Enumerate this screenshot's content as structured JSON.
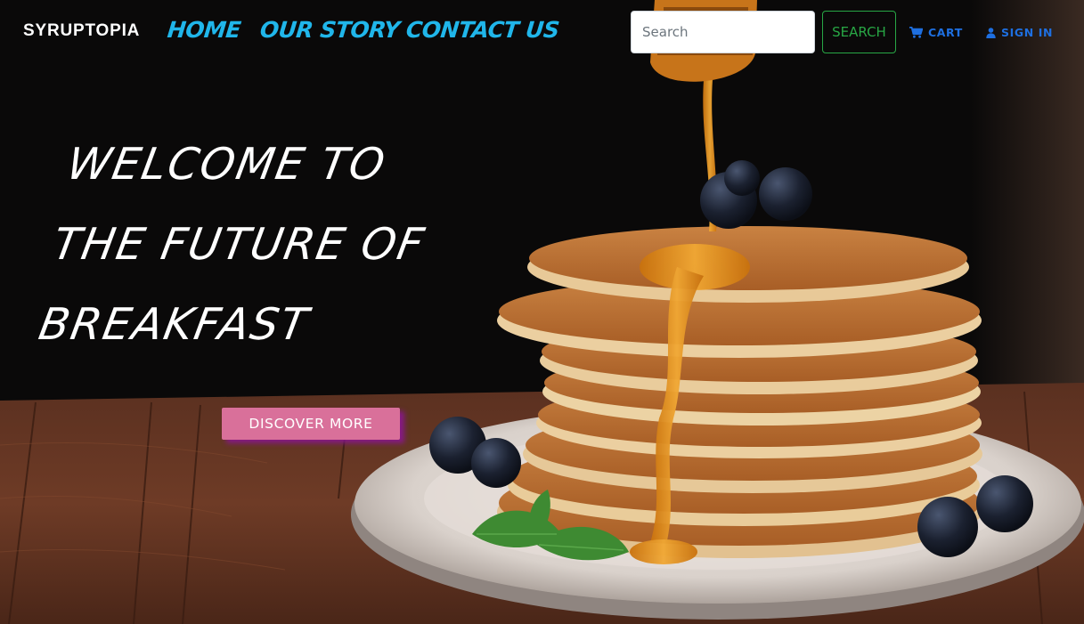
{
  "colors": {
    "nav_link": "#20b6ea",
    "action_link": "#1e6fe0",
    "search_outline": "#28a745",
    "discover_bg": "#d9709a",
    "discover_shadow": "#8c1496"
  },
  "navbar": {
    "brand": "SYRUPTOPIA",
    "links": [
      {
        "label": "HOME"
      },
      {
        "label": "OUR STORY"
      },
      {
        "label": "CONTACT US"
      }
    ],
    "search": {
      "placeholder": "Search",
      "value": "",
      "button_label": "SEARCH"
    },
    "cart": {
      "label": "CART",
      "icon": "shopping-cart-icon"
    },
    "signin": {
      "label": "SIGN IN",
      "icon": "user-icon"
    }
  },
  "hero": {
    "title_lines": [
      "WELCOME TO",
      "THE FUTURE OF",
      "BREAKFAST"
    ],
    "cta_label": "DISCOVER MORE",
    "image_subject": "stack-of-pancakes-with-honey-and-blueberries"
  }
}
